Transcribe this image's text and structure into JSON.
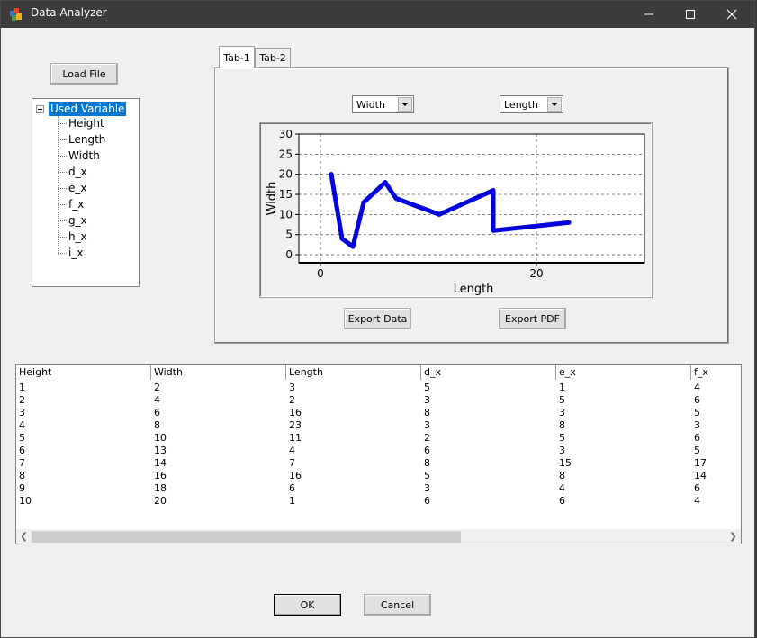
{
  "window": {
    "title": "Data Analyzer",
    "icon": "app-icon",
    "controls": {
      "minimize": "minimize-icon",
      "maximize": "maximize-icon",
      "close": "close-icon"
    }
  },
  "load_button": "Load File",
  "tree": {
    "root": "Used Variable",
    "items": [
      "Height",
      "Length",
      "Width",
      "d_x",
      "e_x",
      "f_x",
      "g_x",
      "h_x",
      "i_x"
    ]
  },
  "tabs": [
    {
      "label": "Tab-1",
      "active": true
    },
    {
      "label": "Tab-2",
      "active": false
    }
  ],
  "y_selector": "Width",
  "x_selector": "Length",
  "chart_data": {
    "type": "line",
    "xlabel": "Length",
    "ylabel": "Width",
    "xlim": [
      -2,
      30
    ],
    "ylim": [
      -2,
      30
    ],
    "x_ticks": [
      0,
      20
    ],
    "y_ticks": [
      0,
      5,
      10,
      15,
      20,
      25,
      30
    ],
    "grid": true,
    "series": [
      {
        "color": "#0000e0",
        "x": [
          1,
          2,
          3,
          4,
          6,
          7,
          11,
          16,
          16,
          23
        ],
        "y": [
          20,
          4,
          2,
          13,
          18,
          14,
          10,
          16,
          6,
          8
        ]
      }
    ]
  },
  "export_data_button": "Export Data",
  "export_pdf_button": "Export PDF",
  "table": {
    "columns": [
      "Height",
      "Width",
      "Length",
      "d_x",
      "e_x",
      "f_x"
    ],
    "rows": [
      [
        "1",
        "2",
        "3",
        "5",
        "1",
        "4"
      ],
      [
        "2",
        "4",
        "2",
        "3",
        "5",
        "6"
      ],
      [
        "3",
        "6",
        "16",
        "8",
        "3",
        "5"
      ],
      [
        "4",
        "8",
        "23",
        "3",
        "8",
        "3"
      ],
      [
        "5",
        "10",
        "11",
        "2",
        "5",
        "6"
      ],
      [
        "6",
        "13",
        "4",
        "6",
        "3",
        "5"
      ],
      [
        "7",
        "14",
        "7",
        "8",
        "15",
        "17"
      ],
      [
        "8",
        "16",
        "16",
        "5",
        "8",
        "14"
      ],
      [
        "9",
        "18",
        "6",
        "3",
        "4",
        "6"
      ],
      [
        "10",
        "20",
        "1",
        "6",
        "6",
        "4"
      ]
    ]
  },
  "ok_button": "OK",
  "cancel_button": "Cancel"
}
